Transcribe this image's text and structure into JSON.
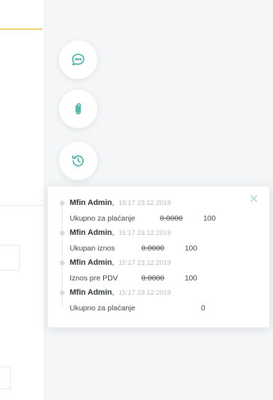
{
  "actions": [
    {
      "id": "comments",
      "icon": "chat-bubble-icon"
    },
    {
      "id": "attachments",
      "icon": "paperclip-icon"
    },
    {
      "id": "history",
      "icon": "history-clock-icon"
    }
  ],
  "accent_color": "#3fb0a3",
  "history_panel": {
    "close_icon": "close-icon",
    "entries": [
      {
        "author": "Mfin Admin",
        "meta": "15:17 23.12.2019",
        "field": "Ukupno za plaćanje",
        "old_value": "0.0000",
        "new_value": "100"
      },
      {
        "author": "Mfin Admin",
        "meta": "15:17 23.12.2019",
        "field": "Ukupan iznos",
        "old_value": "0.0000",
        "new_value": "100"
      },
      {
        "author": "Mfin Admin",
        "meta": "15:17 23.12.2019",
        "field": "Iznos pre PDV",
        "old_value": "0.0000",
        "new_value": "100"
      },
      {
        "author": "Mfin Admin",
        "meta": "15:17 23.12.2019",
        "field": "Ukupno za plaćanje",
        "old_value": "",
        "new_value": "0"
      }
    ]
  }
}
